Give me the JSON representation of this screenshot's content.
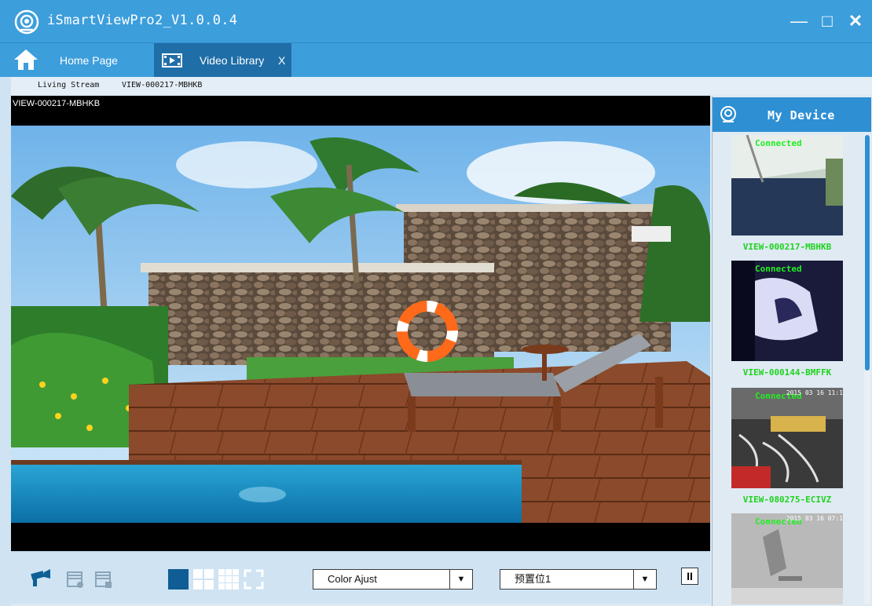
{
  "window": {
    "title": "iSmartViewPro2_V1.0.0.4",
    "minimize_glyph": "—",
    "maximize_glyph": "□",
    "close_glyph": "✕",
    "accent_color": "#3d9edc"
  },
  "tabs": {
    "home_label": "Home Page",
    "video_label": "Video Library",
    "video_close": "X"
  },
  "breadcrumb": {
    "section": "Living Stream",
    "device": "VIEW-000217-MBHKB"
  },
  "video": {
    "overlay_label": "VIEW-000217-MBHKB"
  },
  "controls": {
    "color_select": "Color Ajust",
    "preset_select": "预置位1",
    "dropdown_glyph": "▼",
    "pause_glyph": "II",
    "layout_active": "single"
  },
  "device_panel": {
    "title": "My Device",
    "cameras": [
      {
        "name": "VIEW-000217-MBHKB",
        "status": "Connected",
        "timestamp": ""
      },
      {
        "name": "VIEW-000144-BMFFK",
        "status": "Connected",
        "timestamp": ""
      },
      {
        "name": "VIEW-080275-ECIVZ",
        "status": "Connected",
        "timestamp": "2015 03 16 11:1"
      },
      {
        "name": "",
        "status": "Connected",
        "timestamp": "2015 03 16 07:1"
      }
    ]
  }
}
